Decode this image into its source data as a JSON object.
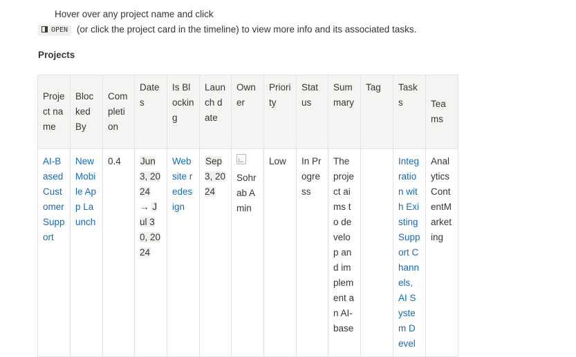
{
  "hint": {
    "line1": "Hover over any project name and click",
    "open_label": "OPEN",
    "line2": "(or click the project card in the timeline) to view more info and its associated tasks."
  },
  "section": {
    "title": "Projects"
  },
  "table": {
    "columns": [
      "Project name",
      "Blocked By",
      "Completion",
      "Dates",
      "Is Blocking",
      "Launch date",
      "Owner",
      "Priority",
      "Status",
      "Summary",
      "Tag",
      "Tasks",
      "Teams"
    ],
    "rows": [
      {
        "project_name": "AI-Based Customer Support",
        "blocked_by": "New Mobile App Launch",
        "completion": "0.4",
        "dates": "Jun 3, 2024 → Jul 30, 2024",
        "dates_start": "Jun 3, 2024",
        "dates_arrow": "→",
        "dates_end": "Jul 30, 2024",
        "is_blocking": "Website redesign",
        "launch_date": "Sep 3, 2024",
        "owner": "Sohrab Amin",
        "priority": "Low",
        "status": "In Progress",
        "summary": "The project aims to develop and implement an AI-base",
        "tag": "",
        "tasks": "Integration with Existing Support Channels, AI System Devel",
        "teams": "AnalyticsContentMarketing"
      }
    ]
  },
  "icons": {
    "open": "open-in-panel-icon",
    "owner_avatar": "broken-image-icon"
  },
  "colors": {
    "link": "#0b6bcb",
    "header_bg": "#f4f4f3",
    "border": "#e3e3e1",
    "text": "#37352f"
  }
}
